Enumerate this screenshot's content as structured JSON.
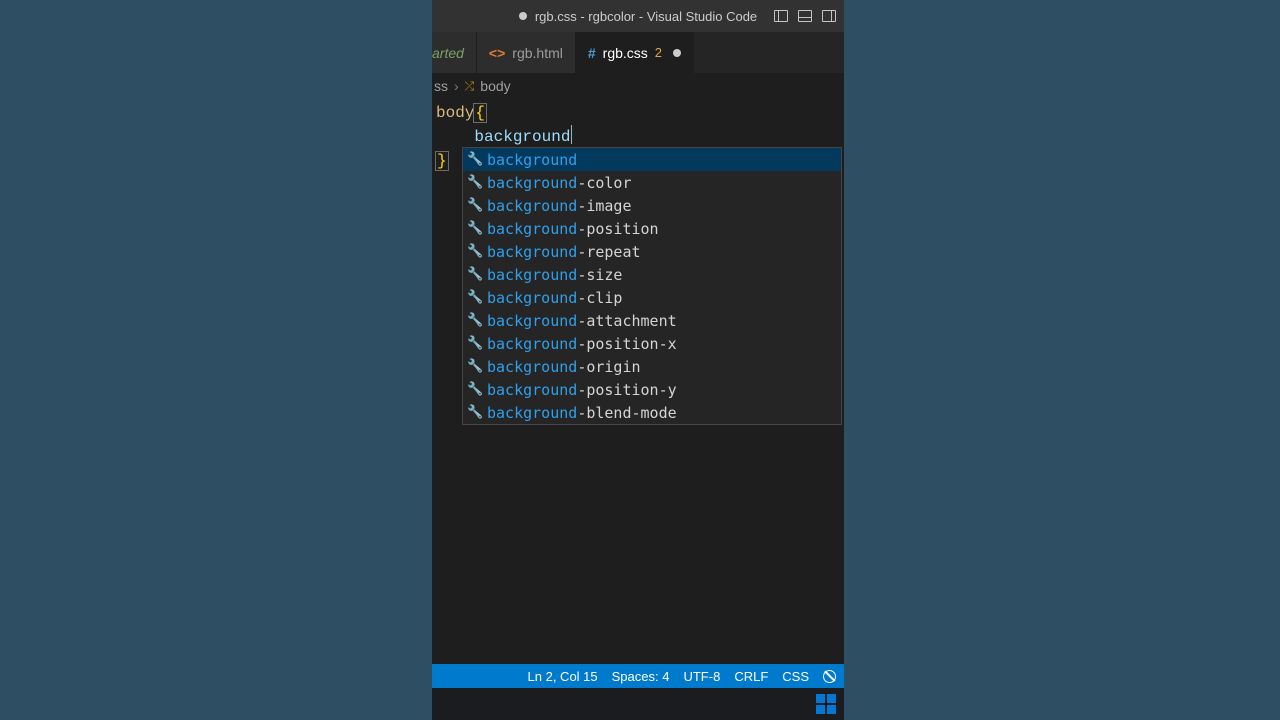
{
  "title": "rgb.css - rgbcolor - Visual Studio Code",
  "tabs": {
    "partial": "arted",
    "html": {
      "icon": "<>",
      "label": "rgb.html"
    },
    "css": {
      "icon": "#",
      "label": "rgb.css",
      "count": "2"
    }
  },
  "breadcrumb": {
    "fileFrag": "ss",
    "sep": "›",
    "symbol": "body"
  },
  "code": {
    "l1_sel": "body",
    "l1_brace": "{",
    "l2_indent": "    ",
    "l2_typed": "background",
    "l3_brace": "}"
  },
  "suggest": {
    "match": "background",
    "items": [
      {
        "suffix": ""
      },
      {
        "suffix": "-color"
      },
      {
        "suffix": "-image"
      },
      {
        "suffix": "-position"
      },
      {
        "suffix": "-repeat"
      },
      {
        "suffix": "-size"
      },
      {
        "suffix": "-clip"
      },
      {
        "suffix": "-attachment"
      },
      {
        "suffix": "-position-x"
      },
      {
        "suffix": "-origin"
      },
      {
        "suffix": "-position-y"
      },
      {
        "suffix": "-blend-mode"
      }
    ]
  },
  "status": {
    "pos": "Ln 2, Col 15",
    "spaces": "Spaces: 4",
    "enc": "UTF-8",
    "eol": "CRLF",
    "lang": "CSS"
  }
}
